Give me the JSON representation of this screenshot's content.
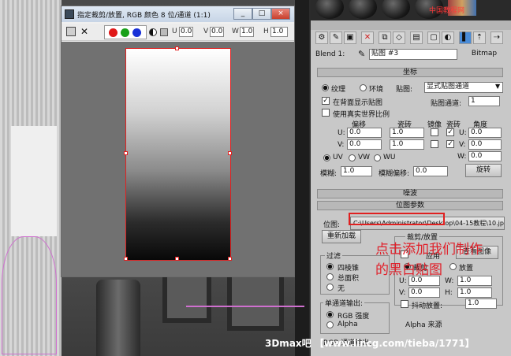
{
  "crop_window": {
    "title": "指定裁剪/放置, RGB 颜色 8 位/通道 (1:1)",
    "controls": [
      "_",
      "□",
      "×"
    ],
    "toolbar": {
      "save_icon": "disk-icon",
      "close_mark": "✕",
      "channel_colors": [
        "#e01818",
        "#18a018",
        "#1830d8"
      ],
      "u_label": "U",
      "u_value": "0.0",
      "v_label": "V",
      "v_value": "0.0",
      "w_label": "W",
      "w_value": "1.0",
      "h_label": "H",
      "h_value": "1.0"
    }
  },
  "material_editor": {
    "top_right_text": "中国教程网",
    "map_label": "Blend 1:",
    "map_name": "贴图 #3",
    "map_type": "Bitmap",
    "coordinates": {
      "header": "坐标",
      "texture": "纹理",
      "environ": "环境",
      "mapping_label": "贴图:",
      "mapping_value": "显式贴图通道",
      "show_map_on_back": "在背面显示贴图",
      "map_channel_label": "贴图通道:",
      "map_channel_value": "1",
      "use_real_world": "使用真实世界比例",
      "col_offset": "偏移",
      "col_tiling": "瓷砖",
      "col_mirror": "镜像",
      "col_tile": "瓷砖",
      "col_angle": "角度",
      "u": "U:",
      "v": "V:",
      "w": "W:",
      "u_offset": "0.0",
      "v_offset": "0.0",
      "u_tiling": "1.0",
      "v_tiling": "1.0",
      "u_angle": "0.0",
      "v_angle": "0.0",
      "w_angle": "0.0",
      "uv": "UV",
      "vw": "VW",
      "wu": "WU",
      "blur_label": "模糊:",
      "blur_value": "1.0",
      "blur_offset_label": "模糊偏移:",
      "blur_offset_value": "0.0",
      "rotate_button": "旋转"
    },
    "noise_header": "噪波",
    "bitmap_params": {
      "header": "位图参数",
      "bitmap_label": "位图:",
      "bitmap_path": "C:\\Users\\Administrator\\Desktop\\04-15教程\\10.jpg",
      "reload_button": "重新加载",
      "crop_group": "裁剪/放置",
      "apply": "应用",
      "view_image": "查看图像",
      "crop": "裁剪",
      "place": "放置",
      "filter_group": "过滤",
      "pyramidal": "四棱锥",
      "summed_area": "总面积",
      "none": "无",
      "u": "U:",
      "v": "V:",
      "u_value": "0.0",
      "v_value": "0.0",
      "jitter_place": "抖动放置:",
      "jitter_value": "1.0",
      "w_value": "1.0",
      "h_value": "1.0",
      "mono_group": "单通道输出:",
      "rgb_intensity": "RGB 强度",
      "alpha": "Alpha",
      "alpha_source": "Alpha 来源",
      "rgb_out": "RGB 通道输出:"
    }
  },
  "annotation": {
    "line1": "点击添加我们制作",
    "line2": "的黑白贴图"
  },
  "watermark": "3Dmax吧 【www.lincg.com/tieba/1771】"
}
